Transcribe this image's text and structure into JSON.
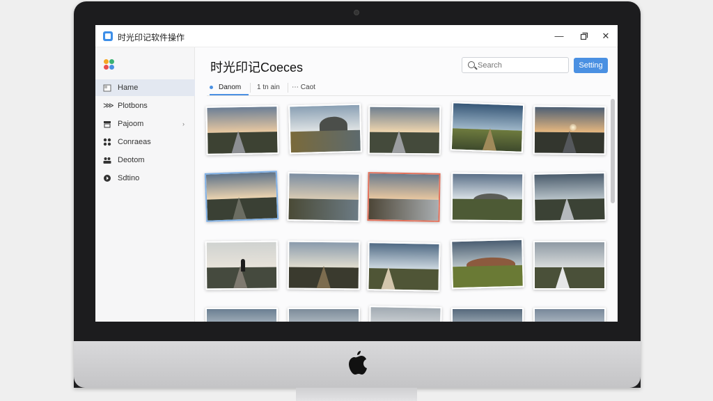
{
  "window": {
    "title": "时光印记软件操作",
    "controls": [
      "minimize-icon",
      "maximize-icon",
      "close-icon"
    ]
  },
  "sidebar": {
    "items": [
      {
        "label": "Hame",
        "icon": "home-icon",
        "active": true
      },
      {
        "label": "Plotbons",
        "icon": "photos-icon",
        "active": false
      },
      {
        "label": "Pajoom",
        "icon": "album-icon",
        "active": false,
        "has_chevron": true
      },
      {
        "label": "Conraeas",
        "icon": "grid-icon",
        "active": false
      },
      {
        "label": "Deotom",
        "icon": "people-icon",
        "active": false
      },
      {
        "label": "Sdtino",
        "icon": "settings-icon",
        "active": false
      }
    ]
  },
  "main": {
    "title": "时光印记Coeces",
    "search_placeholder": "Search",
    "setting_button": "Setting",
    "tabs": [
      {
        "label": "Danom",
        "active": true
      },
      {
        "label": "1 tn ain",
        "active": false
      },
      {
        "label": "Caot",
        "active": false,
        "prefix": "⋯"
      }
    ]
  },
  "colors": {
    "accent": "#4a90e2",
    "selection_blue": "#7fb0e6",
    "selection_red": "#e3705a"
  }
}
